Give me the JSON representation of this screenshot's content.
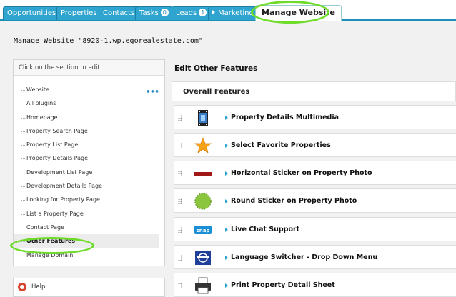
{
  "tabs": [
    {
      "label": "Opportunities"
    },
    {
      "label": "Properties"
    },
    {
      "label": "Contacts"
    },
    {
      "label": "Tasks",
      "badge": "0"
    },
    {
      "label": "Leads",
      "badge": "1"
    },
    {
      "label": "Marketing"
    },
    {
      "label": "Manage Website"
    }
  ],
  "page": {
    "title": "Manage Website \"8920-1.wp.egorealestate.com\""
  },
  "sidebar": {
    "header": "Click on the section to edit",
    "more_icon": "ellipsis-icon",
    "items": [
      {
        "label": "Website"
      },
      {
        "label": "All plugins"
      },
      {
        "label": "Homepage"
      },
      {
        "label": "Property Search Page"
      },
      {
        "label": "Property List Page"
      },
      {
        "label": "Property Details Page"
      },
      {
        "label": "Development List Page"
      },
      {
        "label": "Development Details Page"
      },
      {
        "label": "Looking for Property Page"
      },
      {
        "label": "List a Property Page"
      },
      {
        "label": "Contact Page"
      },
      {
        "label": "Other Features"
      },
      {
        "label": "Manage Domain"
      }
    ],
    "selected": "Other Features"
  },
  "help": {
    "label": "Help",
    "icon": "lifebuoy-icon"
  },
  "main": {
    "title": "Edit Other Features",
    "section": "Overall Features",
    "features": [
      {
        "label": "Property Details Multimedia",
        "icon": "film-icon"
      },
      {
        "label": "Select Favorite Properties",
        "icon": "star-icon"
      },
      {
        "label": "Horizontal Sticker on Property Photo",
        "icon": "horizontal-sticker-icon"
      },
      {
        "label": "Round Sticker on Property Photo",
        "icon": "round-sticker-icon"
      },
      {
        "label": "Live Chat Support",
        "icon": "snap-chat-icon",
        "icon_text": "snap"
      },
      {
        "label": "Language Switcher - Drop Down Menu",
        "icon": "language-flag-icon"
      },
      {
        "label": "Print Property Detail Sheet",
        "icon": "printer-icon"
      }
    ]
  },
  "colors": {
    "tab_blue": "#2ea4cf",
    "highlight_green": "#6fdc2a",
    "sticker_red": "#a01818",
    "sticker_green": "#8cc63f",
    "star_gold": "#f7a21b"
  }
}
